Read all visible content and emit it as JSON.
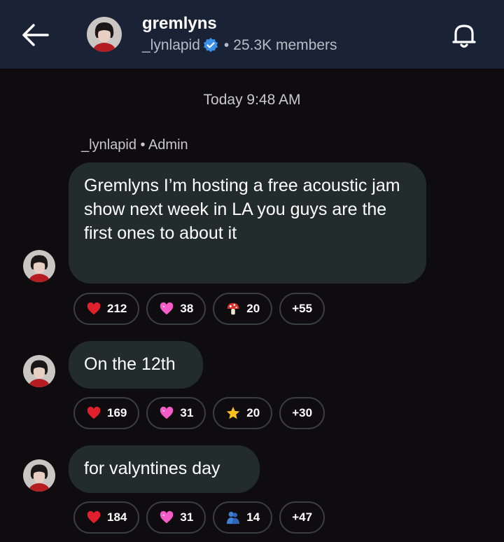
{
  "header": {
    "title": "gremlyns",
    "owner": "_lynlapid",
    "separator": "•",
    "members": "25.3K members"
  },
  "timestamp": "Today 9:48 AM",
  "author_line": "_lynlapid • Admin",
  "colors": {
    "header_bg": "#1a2335",
    "page_bg": "#0e0c0f",
    "bubble_bg": "#222d2b",
    "verified": "#3b8fe8"
  },
  "messages": [
    {
      "text": "Gremlyns I’m hosting a free acoustic jam show next week in LA you guys are the first ones to about it",
      "reactions": [
        {
          "emoji": "red-heart",
          "count": "212"
        },
        {
          "emoji": "pink-heart",
          "count": "38"
        },
        {
          "emoji": "mushroom",
          "count": "20"
        },
        {
          "emoji": "more",
          "count": "+55"
        }
      ]
    },
    {
      "text": "On the 12th",
      "reactions": [
        {
          "emoji": "red-heart",
          "count": "169"
        },
        {
          "emoji": "pink-heart",
          "count": "31"
        },
        {
          "emoji": "star",
          "count": "20"
        },
        {
          "emoji": "more",
          "count": "+30"
        }
      ]
    },
    {
      "text": "for valyntines day",
      "reactions": [
        {
          "emoji": "red-heart",
          "count": "184"
        },
        {
          "emoji": "pink-heart",
          "count": "31"
        },
        {
          "emoji": "people-hugging",
          "count": "14"
        },
        {
          "emoji": "more",
          "count": "+47"
        }
      ]
    }
  ]
}
